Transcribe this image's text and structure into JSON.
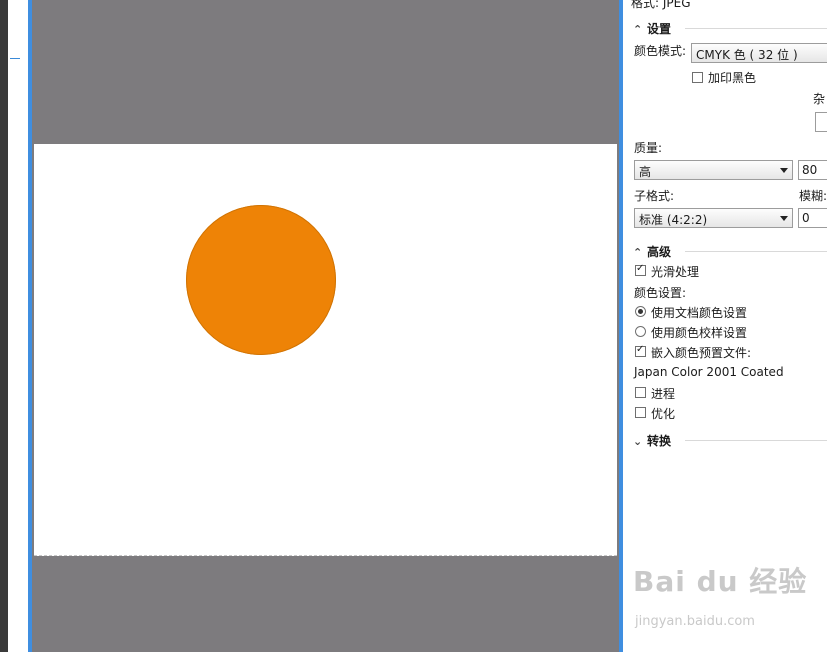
{
  "panel": {
    "format_line": "格式: JPEG",
    "settings": {
      "title": "设置",
      "color_mode_label": "颜色模式:",
      "color_mode_value": "CMYK 色 ( 32 位 )",
      "overprint_black_label": "加印黑色",
      "overprint_black_checked": false,
      "noise_label": "杂",
      "quality_label": "质量:",
      "quality_value": "高",
      "quality_number": "80",
      "subformat_label": "子格式:",
      "subformat_value": "标准 (4:2:2)",
      "blur_label": "模糊:",
      "blur_value": "0"
    },
    "advanced": {
      "title": "高级",
      "smoothing_label": "光滑处理",
      "smoothing_checked": true,
      "color_settings_label": "颜色设置:",
      "use_document_color_label": "使用文档颜色设置",
      "use_proof_color_label": "使用颜色校样设置",
      "selected_color_option": "use_document_color",
      "embed_profile_label": "嵌入颜色预置文件:",
      "embed_profile_checked": true,
      "profile_name": "Japan Color 2001 Coated",
      "progressive_label": "进程",
      "progressive_checked": false,
      "optimize_label": "优化",
      "optimize_checked": false
    },
    "transform": {
      "title": "转换"
    }
  },
  "watermark": {
    "main": "Bai du 经验",
    "sub": "jingyan.baidu.com"
  },
  "colors": {
    "accent_blue": "#3f8ee0",
    "preview_gray": "#7d7b7e",
    "circle_orange": "#ee8306"
  },
  "icons": {
    "section_expanded": "chevron-up-double-icon",
    "section_collapsed": "chevron-down-double-icon",
    "dropdown": "dropdown-arrow-icon"
  }
}
